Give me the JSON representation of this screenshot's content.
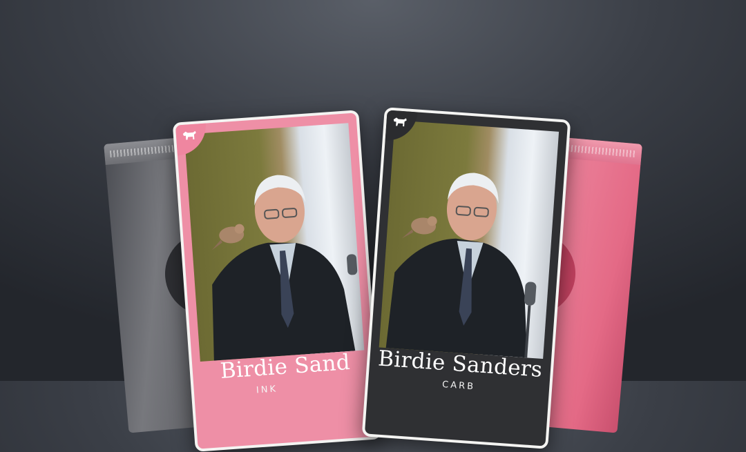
{
  "colors": {
    "background": "#3b3f47",
    "pink_card": "#ee8fa6",
    "dark_card": "#2f3033",
    "pink_pack": "#e46a86",
    "gray_pack": "#6a6b70"
  },
  "packs": [
    {
      "id": "gray",
      "emblem_icon": "circle-emblem"
    },
    {
      "id": "pink",
      "emblem_icon": "circle-emblem"
    }
  ],
  "cards": {
    "pink": {
      "name": "Birdie Sand",
      "subtitle": "INK",
      "badge_icon": "donkey-icon"
    },
    "dark": {
      "name": "Birdie Sanders",
      "subtitle": "CARB",
      "badge_icon": "donkey-icon"
    }
  }
}
